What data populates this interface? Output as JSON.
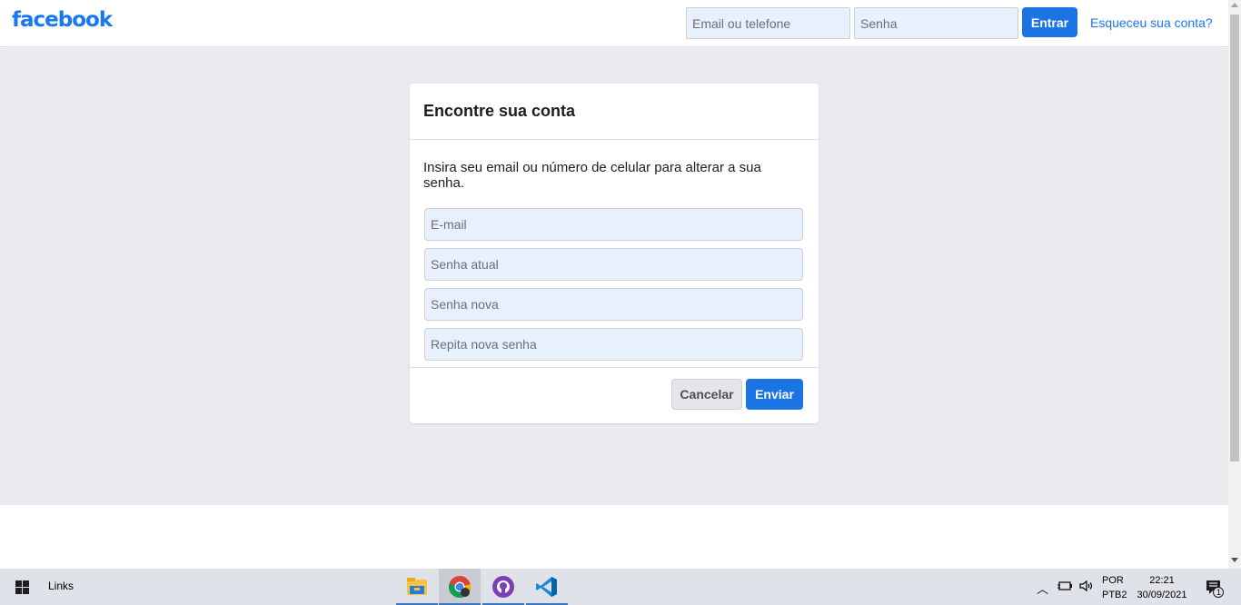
{
  "header": {
    "logo_text": "facebook",
    "email_placeholder": "Email ou telefone",
    "password_placeholder": "Senha",
    "login_label": "Entrar",
    "forgot_link": "Esqueceu sua conta?"
  },
  "card": {
    "title": "Encontre sua conta",
    "instructions": "Insira seu email ou número de celular para alterar a sua senha.",
    "fields": {
      "email_placeholder": "E-mail",
      "current_password_placeholder": "Senha atual",
      "new_password_placeholder": "Senha nova",
      "repeat_password_placeholder": "Repita nova senha"
    },
    "cancel_label": "Cancelar",
    "send_label": "Enviar"
  },
  "taskbar": {
    "toolbar_label": "Links",
    "apps": [
      {
        "name": "File Explorer",
        "icon": "folder-icon",
        "active": false
      },
      {
        "name": "Google Chrome",
        "icon": "chrome-icon",
        "active": true
      },
      {
        "name": "GitHub Desktop",
        "icon": "github-icon",
        "active": false
      },
      {
        "name": "Visual Studio Code",
        "icon": "vscode-icon",
        "active": false
      }
    ],
    "language": "POR",
    "keyboard": "PTB2",
    "time": "22:21",
    "date": "30/09/2021",
    "notification_count": "1"
  },
  "colors": {
    "brand": "#1877f2",
    "button": "#1b74e4",
    "background": "#e9ebee",
    "input_fill": "#e8f0fe"
  }
}
